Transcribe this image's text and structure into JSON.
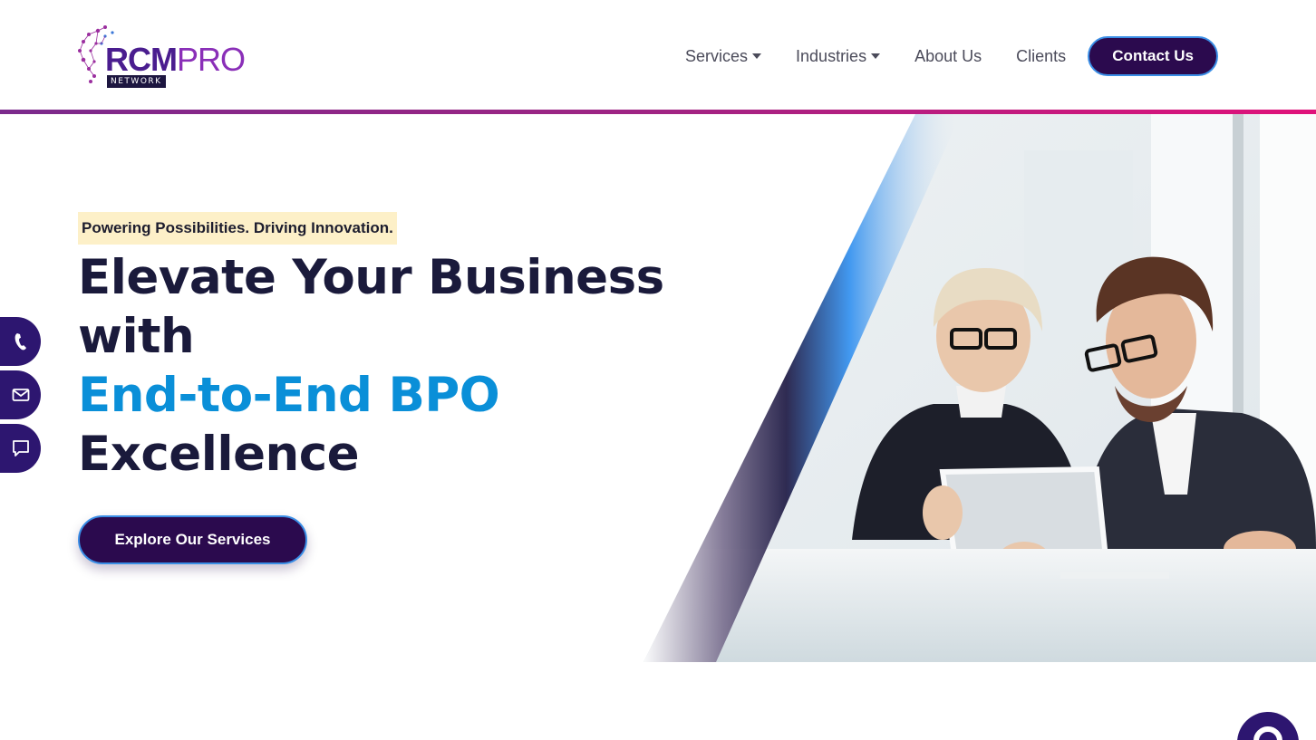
{
  "brand": {
    "name_part1": "RCM",
    "name_part2": "PRO",
    "subtitle": "NETWORK"
  },
  "nav": {
    "items": [
      {
        "label": "Services",
        "dropdown": true
      },
      {
        "label": "Industries",
        "dropdown": true
      },
      {
        "label": "About Us",
        "dropdown": false
      },
      {
        "label": "Clients",
        "dropdown": false
      }
    ],
    "contact_label": "Contact Us"
  },
  "hero": {
    "tagline": "Powering Possibilities. Driving Innovation.",
    "headline_line1": "Elevate Your Business",
    "headline_line2": "with",
    "headline_accent": "End-to-End BPO",
    "headline_line4": "Excellence",
    "cta_label": "Explore Our Services"
  },
  "side_tabs": [
    {
      "icon": "phone-icon"
    },
    {
      "icon": "mail-icon"
    },
    {
      "icon": "chat-icon"
    }
  ],
  "colors": {
    "primary": "#2b0a4e",
    "accent_blue": "#0a8fd8",
    "header_gradient_start": "#7b2a8c",
    "header_gradient_end": "#e0127a",
    "tagline_bg": "#fdf0c8"
  }
}
